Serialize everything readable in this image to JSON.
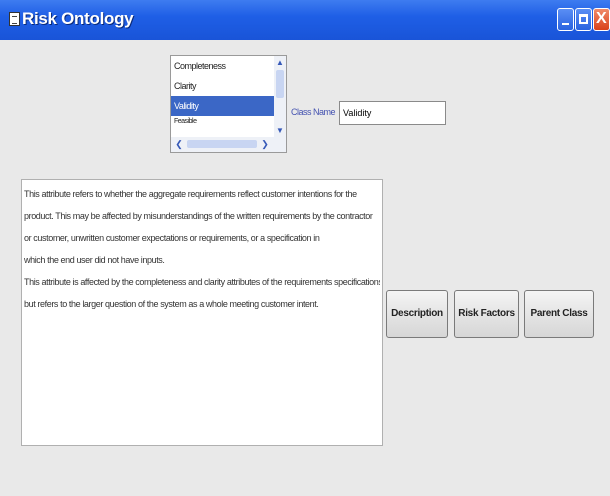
{
  "window": {
    "title": "Risk Ontology",
    "close_glyph": "X"
  },
  "class_list": {
    "items": [
      "Completeness",
      "Clarity",
      "Validity",
      "Feasible"
    ],
    "selected_index": 2
  },
  "class_name": {
    "label": "Class Name",
    "value": "Validity"
  },
  "description": {
    "lines": [
      "This attribute refers to whether the aggregate requirements reflect customer intentions for the",
      "product. This may be affected by misunderstandings of the written requirements by the contractor",
      "or customer, unwritten customer expectations or requirements, or a specification in",
      "which the end user did not have inputs.",
      "This attribute is affected by the completeness and clarity attributes of the requirements specifications,",
      "but refers to the larger question of the system as a whole meeting customer intent."
    ]
  },
  "buttons": {
    "description": "Description",
    "risk_factors": "Risk Factors",
    "parent_class": "Parent Class"
  },
  "colors": {
    "titlebar": "#1f5fe6",
    "selection": "#3b67c6",
    "window_bg": "#e9e9e9"
  }
}
